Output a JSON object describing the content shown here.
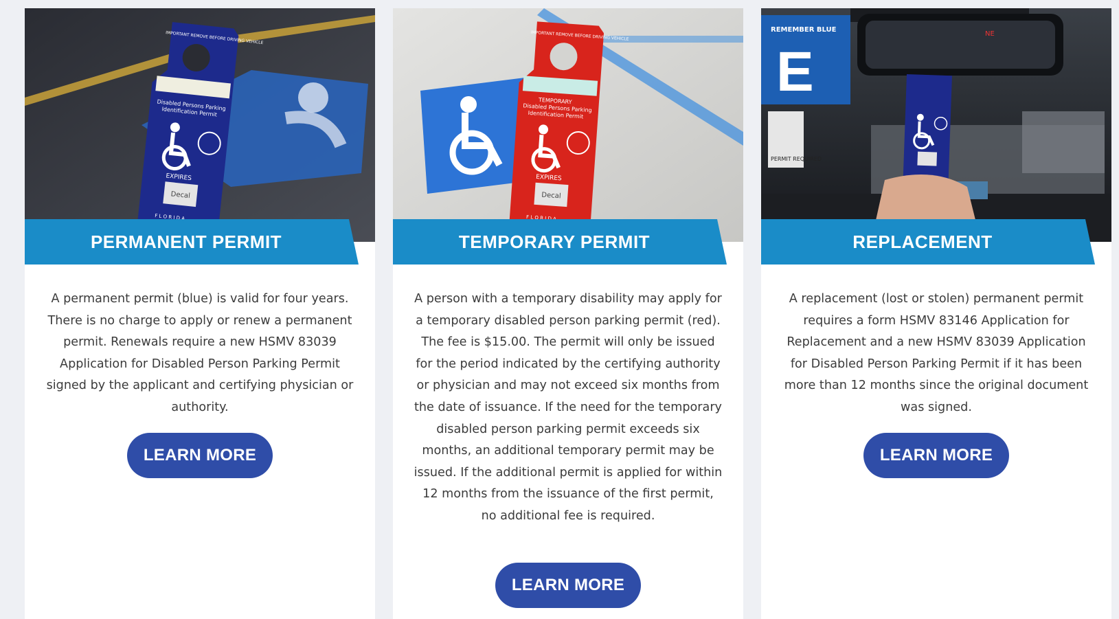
{
  "cards": [
    {
      "title": "PERMANENT PERMIT",
      "description": "A permanent permit (blue) is valid for four years. There is no charge to apply or renew a permanent permit. Renewals require a new HSMV 83039 Application for Disabled Person Parking Permit signed by the applicant and certifying physician or authority.",
      "button": "LEARN MORE",
      "image": {
        "tag_header": "IMPORTANT REMOVE BEFORE DRIVING VEHICLE",
        "tag_title": "Disabled Persons Parking Identification Permit",
        "expires": "EXPIRES",
        "decal": "Decal",
        "state": "F L O R I D A",
        "tag_color": "#1d2a8c"
      }
    },
    {
      "title": "TEMPORARY PERMIT",
      "description": "A person with a temporary disability may apply for a temporary disabled person parking permit (red). The fee is $15.00. The permit will only be issued for the period indicated by the certifying authority or physician and may not exceed six months from the date of issuance. If the need for the temporary disabled person parking permit exceeds six months, an additional temporary permit may be issued. If the additional permit is applied for within 12 months from the issuance of the first permit, no additional fee is required.",
      "button": "LEARN MORE",
      "image": {
        "tag_header": "IMPORTANT REMOVE BEFORE DRIVING VEHICLE",
        "tag_title": "TEMPORARY Disabled Persons Parking Identification Permit",
        "expires": "EXPIRES",
        "decal": "Decal",
        "state": "F L O R I D A",
        "tag_color": "#d8241c"
      }
    },
    {
      "title": "REPLACEMENT",
      "description": "A replacement (lost or stolen) permanent permit requires a form HSMV 83146 Application for Replacement and a new HSMV 83039 Application for Disabled Person Parking Permit if it has been more than 12 months since the original document was signed.",
      "button": "LEARN MORE",
      "image": {
        "sign_letter": "E",
        "sign_text": "REMEMBER BLUE",
        "permit_sign": "PERMIT REQUIRED",
        "mirror_text": "NE",
        "tag_color": "#1d2a8c"
      }
    }
  ],
  "colors": {
    "banner": "#1a8cc8",
    "button": "#2f4da8",
    "text": "#3b3b3b",
    "background": "#eef0f4"
  }
}
